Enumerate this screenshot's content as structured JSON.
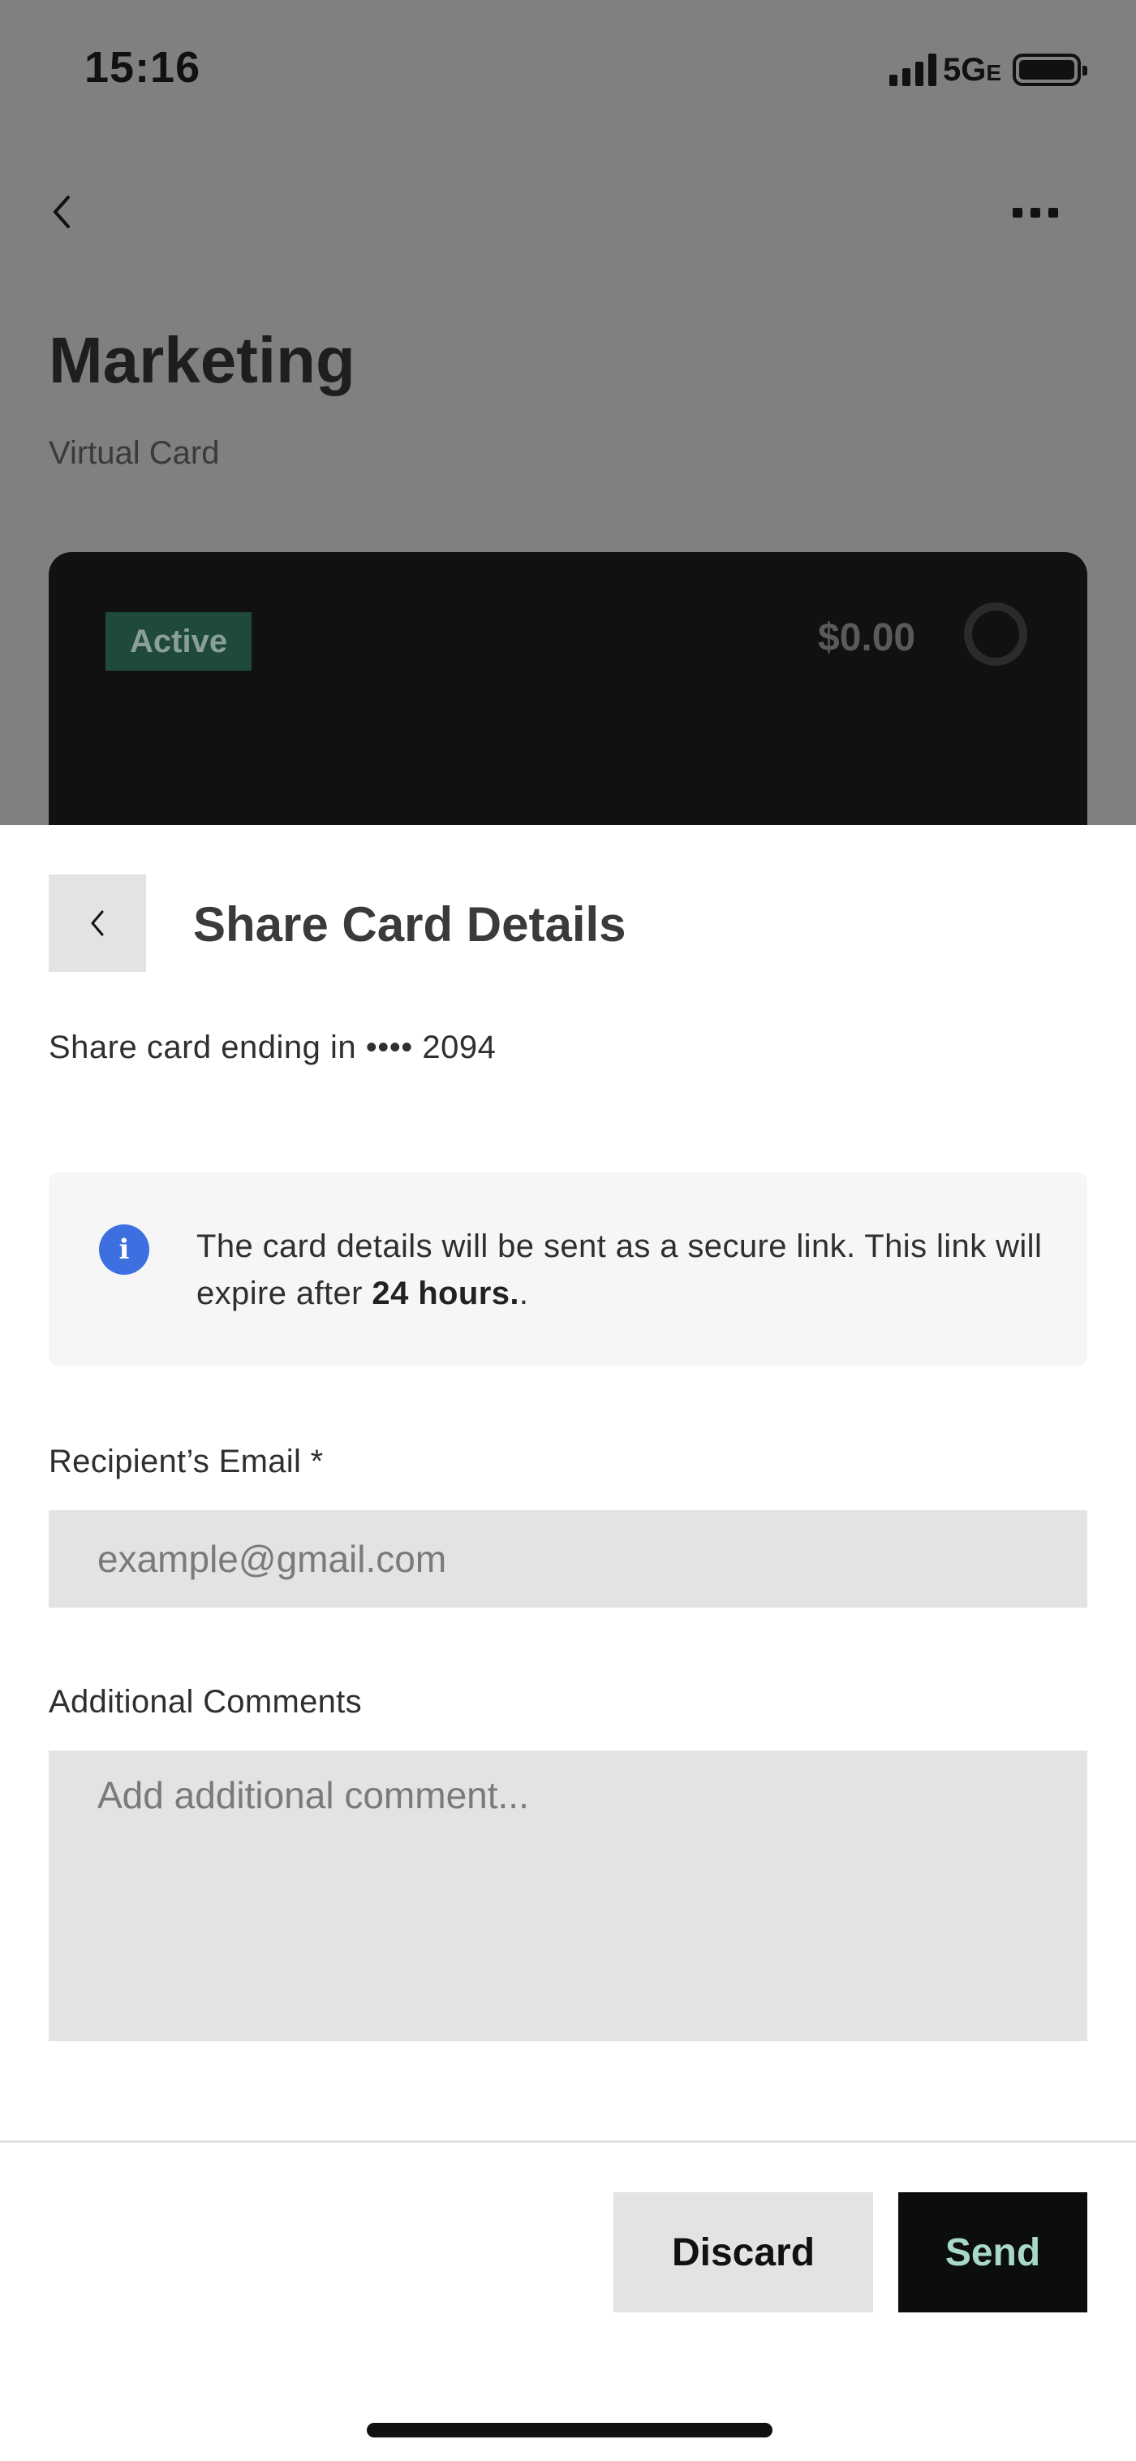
{
  "status_bar": {
    "time": "15:16",
    "network": "5G",
    "network_suffix": "E"
  },
  "background_page": {
    "title": "Marketing",
    "subtitle": "Virtual Card",
    "card": {
      "status": "Active",
      "balance": "$0.00",
      "status_color": "#1f4a3a"
    }
  },
  "sheet": {
    "title": "Share Card Details",
    "subtitle": "Share card ending in •••• 2094",
    "info": {
      "text_before": "The card details will be sent as a secure link. This link will expire after ",
      "text_bold": "24 hours.",
      "text_after": ".",
      "icon_glyph": "i",
      "icon_color": "#3d6fe0"
    },
    "email": {
      "label": "Recipient’s Email *",
      "placeholder": "example@gmail.com",
      "value": ""
    },
    "comments": {
      "label": "Additional Comments",
      "placeholder": "Add additional comment...",
      "value": ""
    },
    "actions": {
      "discard_label": "Discard",
      "send_label": "Send"
    }
  },
  "colors": {
    "overlay": "#808080",
    "send_bg": "#0c0e0d",
    "send_text": "#a8d9c6",
    "field_bg": "#e3e3e3"
  }
}
